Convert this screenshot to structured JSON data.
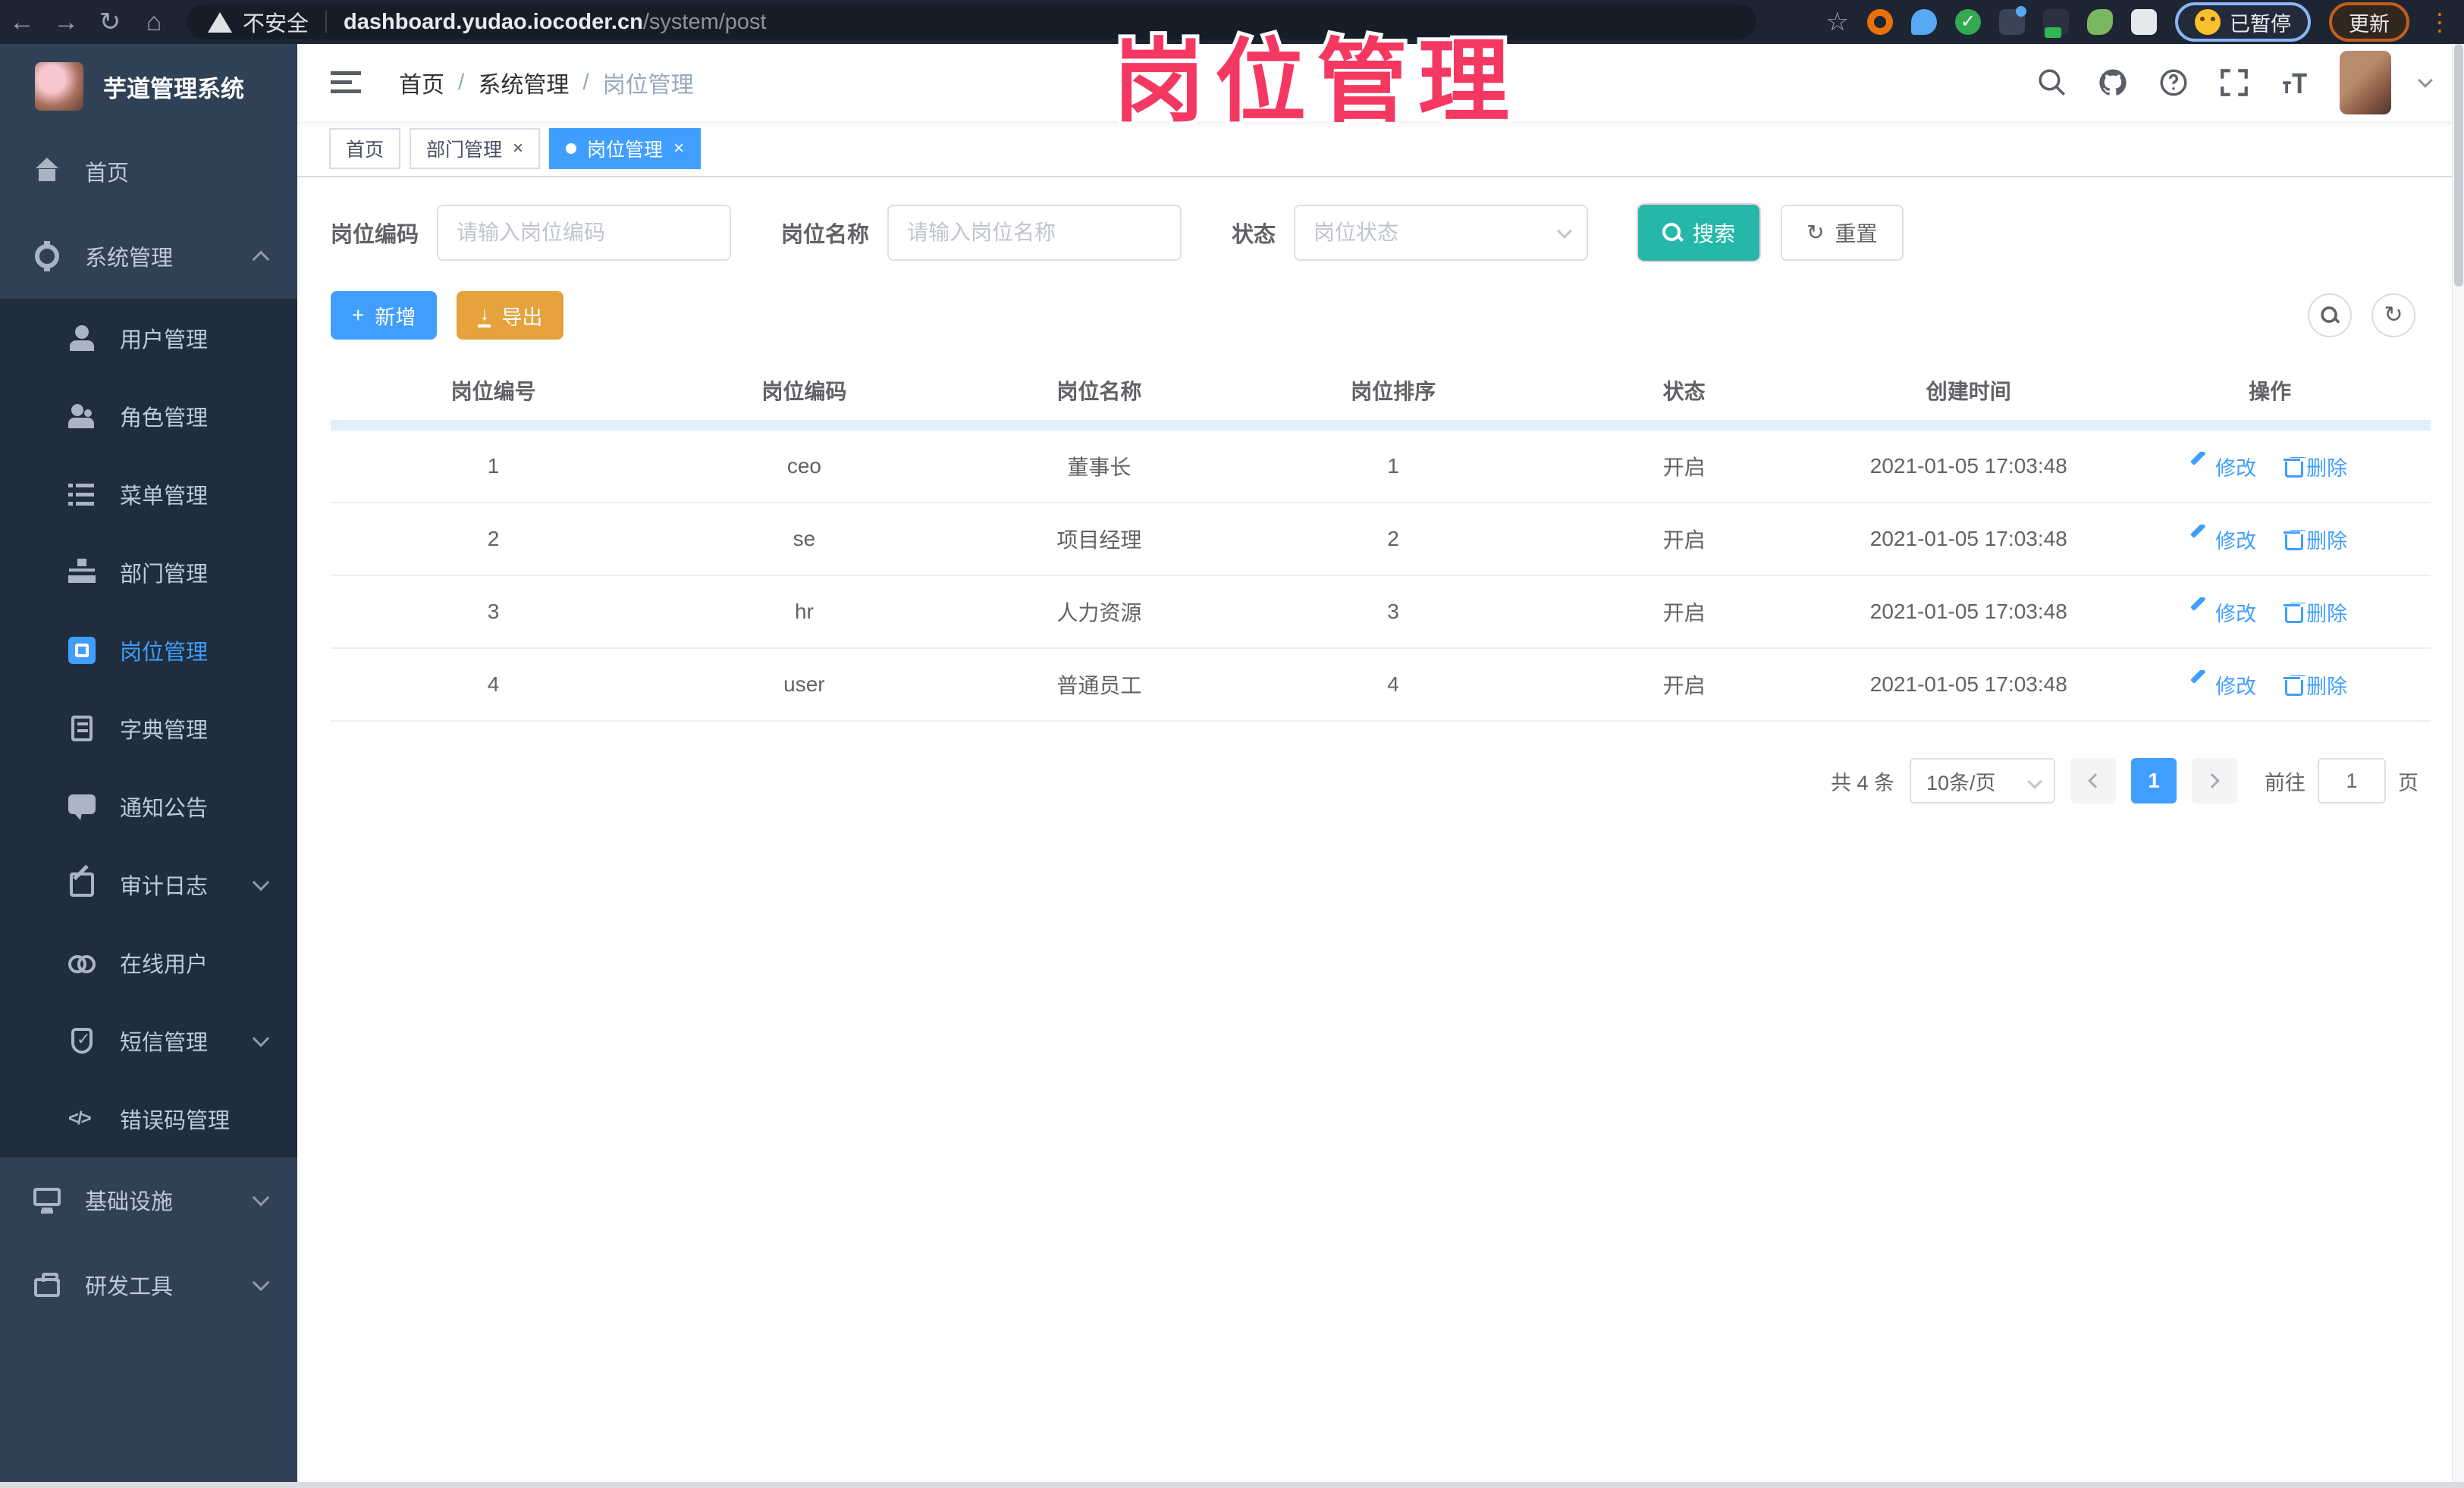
{
  "overlay": {
    "title": "岗位管理"
  },
  "browser": {
    "security_label": "不安全",
    "url_host": "dashboard.yudao.iocoder.cn",
    "url_path": "/system/post",
    "paused_label": "已暂停",
    "update_label": "更新",
    "menu_dots": "⋮",
    "back_icon": "←",
    "forward_icon": "→",
    "reload_icon": "↻",
    "home_icon": "⌂",
    "star_icon": "☆"
  },
  "sidebar": {
    "app_title": "芋道管理系统",
    "items": [
      {
        "label": "首页",
        "icon": "home"
      },
      {
        "label": "系统管理",
        "icon": "gear",
        "arrow": "up",
        "children": [
          {
            "label": "用户管理",
            "icon": "user"
          },
          {
            "label": "角色管理",
            "icon": "role"
          },
          {
            "label": "菜单管理",
            "icon": "menu"
          },
          {
            "label": "部门管理",
            "icon": "dept"
          },
          {
            "label": "岗位管理",
            "icon": "post",
            "active": true
          },
          {
            "label": "字典管理",
            "icon": "dict"
          },
          {
            "label": "通知公告",
            "icon": "notice"
          },
          {
            "label": "审计日志",
            "icon": "log",
            "arrow": "down"
          },
          {
            "label": "在线用户",
            "icon": "online"
          },
          {
            "label": "短信管理",
            "icon": "sms",
            "arrow": "down"
          },
          {
            "label": "错误码管理",
            "icon": "code"
          }
        ]
      },
      {
        "label": "基础设施",
        "icon": "infra",
        "arrow": "down"
      },
      {
        "label": "研发工具",
        "icon": "tool",
        "arrow": "down"
      }
    ]
  },
  "header": {
    "breadcrumb": [
      "首页",
      "系统管理",
      "岗位管理"
    ]
  },
  "tabs": [
    {
      "label": "首页",
      "closable": false,
      "active": false
    },
    {
      "label": "部门管理",
      "closable": true,
      "active": false
    },
    {
      "label": "岗位管理",
      "closable": true,
      "active": true
    }
  ],
  "filters": {
    "code_label": "岗位编码",
    "code_placeholder": "请输入岗位编码",
    "name_label": "岗位名称",
    "name_placeholder": "请输入岗位名称",
    "status_label": "状态",
    "status_placeholder": "岗位状态",
    "search_label": "搜索",
    "reset_label": "重置"
  },
  "toolbar": {
    "add_label": "新增",
    "export_label": "导出"
  },
  "table": {
    "columns": [
      "岗位编号",
      "岗位编码",
      "岗位名称",
      "岗位排序",
      "状态",
      "创建时间",
      "操作"
    ],
    "rows": [
      {
        "id": "1",
        "code": "ceo",
        "name": "董事长",
        "sort": "1",
        "status": "开启",
        "created": "2021-01-05 17:03:48"
      },
      {
        "id": "2",
        "code": "se",
        "name": "项目经理",
        "sort": "2",
        "status": "开启",
        "created": "2021-01-05 17:03:48"
      },
      {
        "id": "3",
        "code": "hr",
        "name": "人力资源",
        "sort": "3",
        "status": "开启",
        "created": "2021-01-05 17:03:48"
      },
      {
        "id": "4",
        "code": "user",
        "name": "普通员工",
        "sort": "4",
        "status": "开启",
        "created": "2021-01-05 17:03:48"
      }
    ],
    "edit_label": "修改",
    "delete_label": "删除"
  },
  "pagination": {
    "total_text": "共 4 条",
    "page_size": "10条/页",
    "current_page": "1",
    "jump_prefix": "前往",
    "jump_value": "1",
    "jump_suffix": "页"
  },
  "colors": {
    "accent_blue": "#409eff",
    "teal": "#25b8a8",
    "warning": "#e6a23c",
    "pink": "#f43862"
  }
}
